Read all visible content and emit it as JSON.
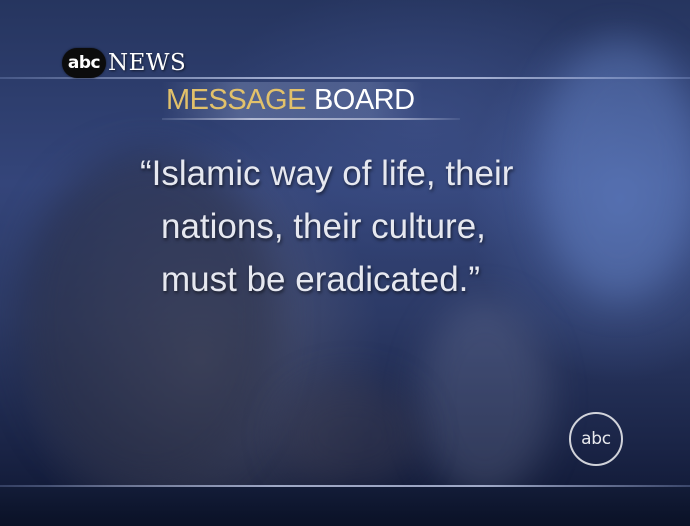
{
  "brand": {
    "logo_text": "abc",
    "network_text": "NEWS",
    "watermark_text": "abc"
  },
  "segment": {
    "title_word1": "MESSAGE",
    "title_word2": "BOARD",
    "title_word1_color": "#e2c16a",
    "title_word2_color": "#ffffff"
  },
  "quote": {
    "lines": [
      "“Islamic way of life, their",
      "nations, their culture,",
      "must be eradicated.”"
    ]
  }
}
